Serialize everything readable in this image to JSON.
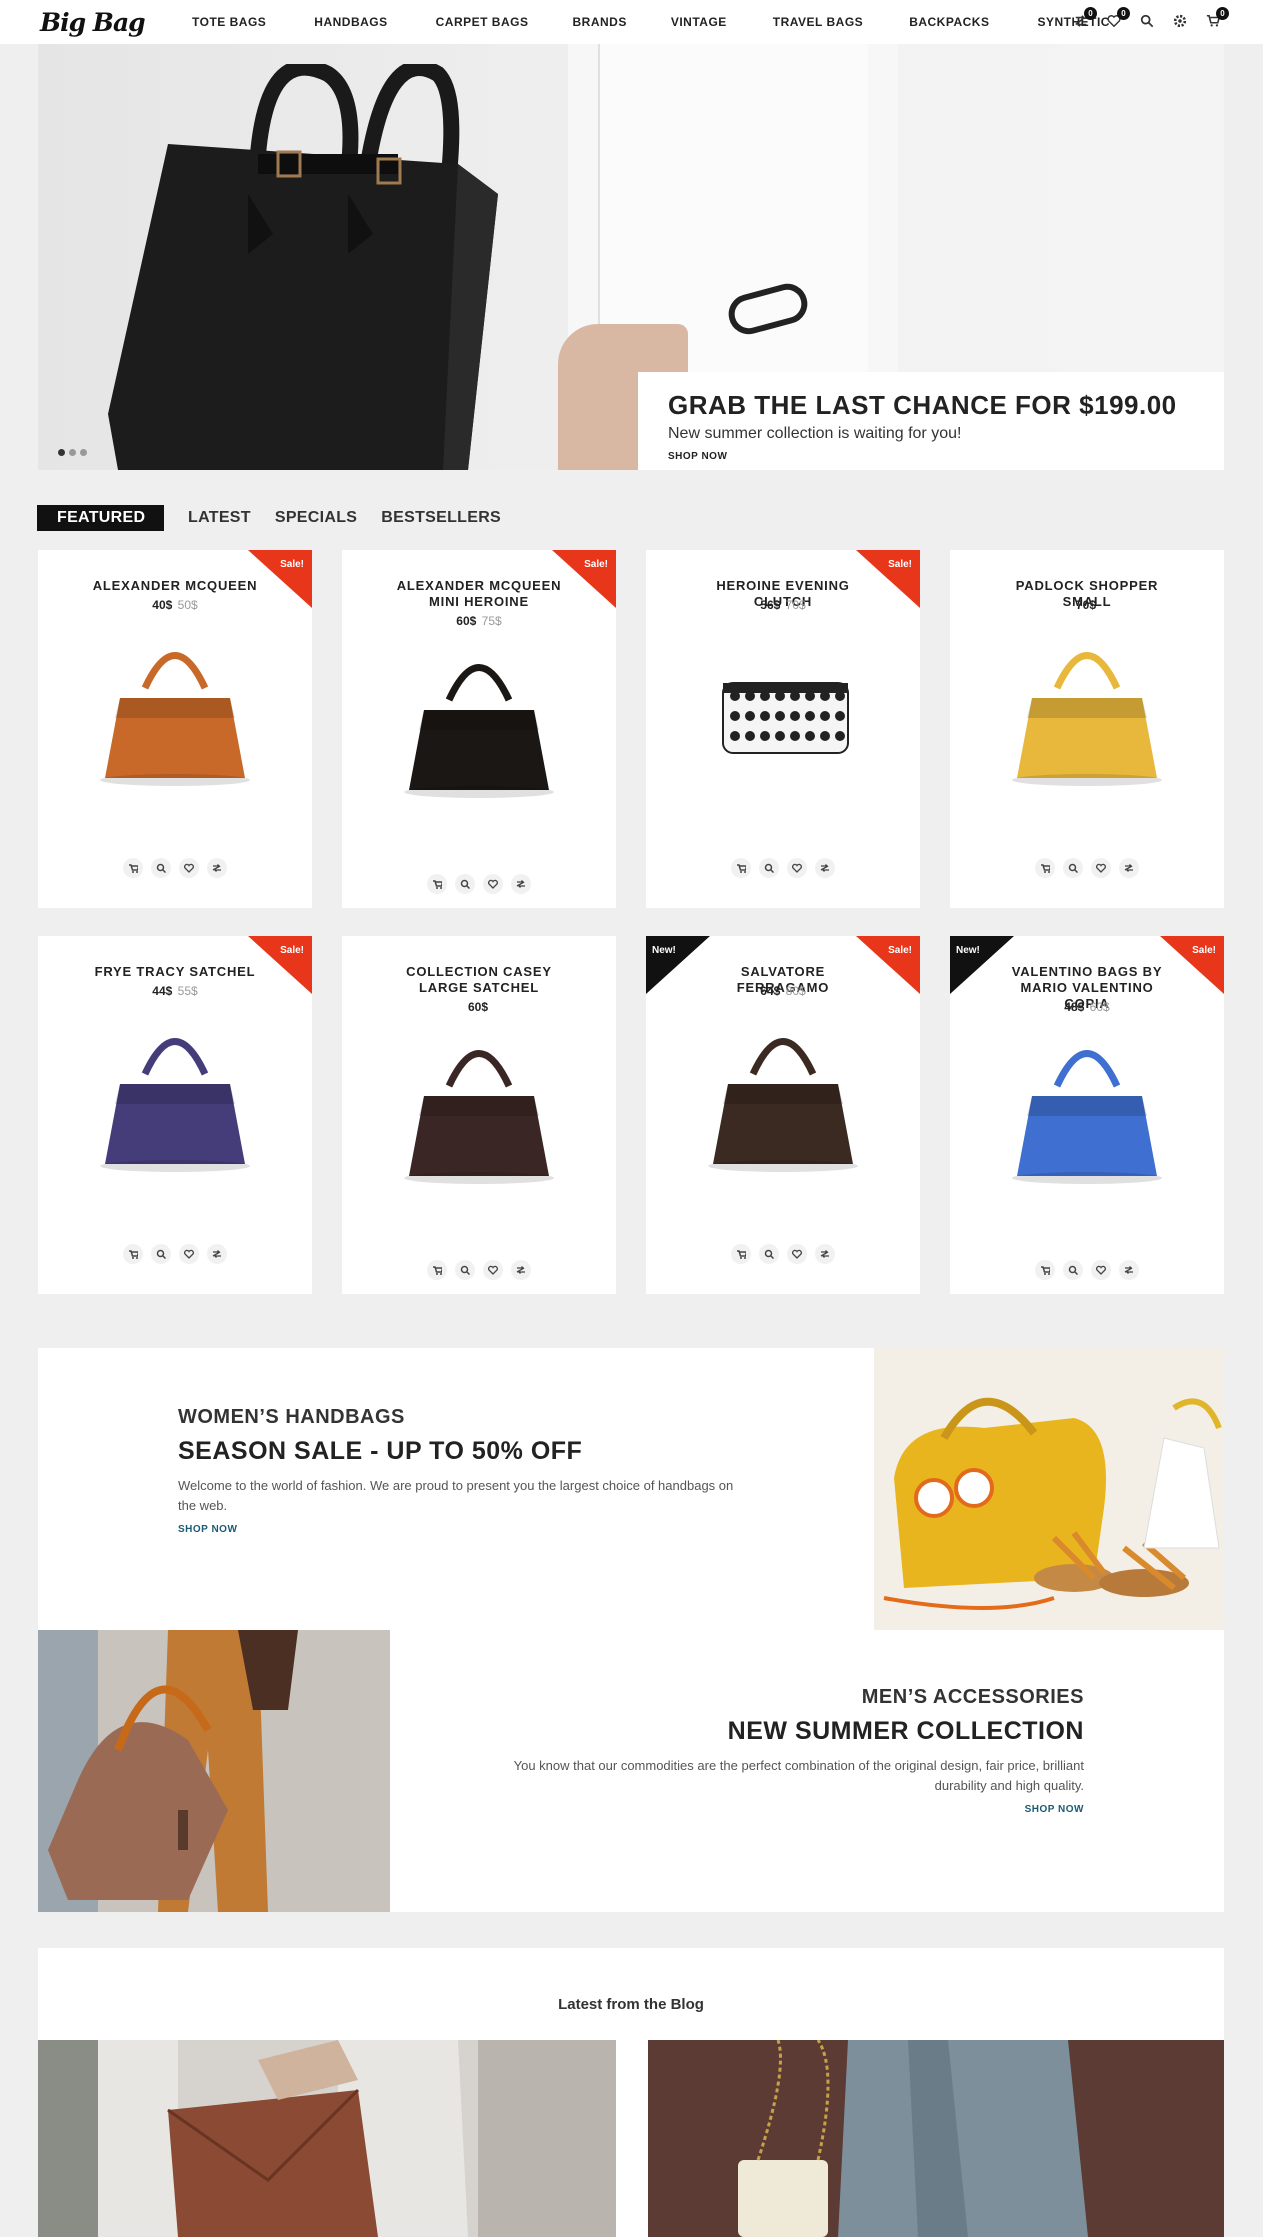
{
  "header": {
    "logo": "Big Bag",
    "nav": [
      "TOTE BAGS",
      "HANDBAGS",
      "CARPET BAGS",
      "BRANDS",
      "VINTAGE",
      "TRAVEL BAGS",
      "BACKPACKS",
      "SYNTHETIC"
    ],
    "icons": [
      {
        "name": "compare-icon",
        "badge": "0"
      },
      {
        "name": "wishlist-icon",
        "badge": "0"
      },
      {
        "name": "search-icon",
        "badge": null
      },
      {
        "name": "settings-icon",
        "badge": null
      },
      {
        "name": "cart-icon",
        "badge": "0"
      }
    ]
  },
  "hero": {
    "title": "GRAB THE LAST CHANCE FOR $199.00",
    "subtitle": "New summer collection is waiting for you!",
    "link": "SHOP NOW",
    "slides": 3,
    "active_slide": 1
  },
  "tabs": [
    "FEATURED",
    "LATEST",
    "SPECIALS",
    "BESTSELLERS"
  ],
  "active_tab": "FEATURED",
  "products": [
    {
      "name": "ALEXANDER MCQUEEN",
      "price": "40$",
      "old_price": "50$",
      "badge_sale": "Sale!",
      "badge_new": null,
      "color": "#c8692a"
    },
    {
      "name": "ALEXANDER MCQUEEN MINI HEROINE",
      "price": "60$",
      "old_price": "75$",
      "badge_sale": "Sale!",
      "badge_new": null,
      "color": "#1a1715"
    },
    {
      "name": "HEROINE EVENING CLUTCH",
      "price": "56$",
      "old_price": "70$",
      "badge_sale": "Sale!",
      "badge_new": null,
      "color": "#222222"
    },
    {
      "name": "PADLOCK SHOPPER SMALL",
      "price": "70$",
      "old_price": "",
      "badge_sale": null,
      "badge_new": null,
      "color": "#e8b83d"
    },
    {
      "name": "FRYE TRACY SATCHEL",
      "price": "44$",
      "old_price": "55$",
      "badge_sale": "Sale!",
      "badge_new": null,
      "color": "#453c7a"
    },
    {
      "name": "COLLECTION CASEY LARGE SATCHEL",
      "price": "60$",
      "old_price": "",
      "badge_sale": null,
      "badge_new": null,
      "color": "#3a2624"
    },
    {
      "name": "SALVATORE FERRAGAMO",
      "price": "64$",
      "old_price": "80$",
      "badge_sale": "Sale!",
      "badge_new": "New!",
      "color": "#3a2a22"
    },
    {
      "name": "VALENTINO BAGS BY MARIO VALENTINO COPIA",
      "price": "48$",
      "old_price": "60$",
      "badge_sale": "Sale!",
      "badge_new": "New!",
      "color": "#3f6fd0"
    }
  ],
  "promo_women": {
    "kicker": "WOMEN’S HANDBAGS",
    "title": "SEASON SALE - UP TO 50% OFF",
    "desc": "Welcome to the world of fashion. We are proud to present you the largest choice of handbags on the web.",
    "link": "SHOP NOW"
  },
  "promo_men": {
    "kicker": "MEN’S ACCESSORIES",
    "title": "NEW SUMMER COLLECTION",
    "desc": "You know that our commodities are the perfect combination of the original design, fair price, brilliant durability and high quality.",
    "link": "SHOP NOW"
  },
  "blog": {
    "title": "Latest from the Blog"
  },
  "colors": {
    "sale": "#e8361b",
    "new": "#111111",
    "link": "#1b5b75"
  }
}
